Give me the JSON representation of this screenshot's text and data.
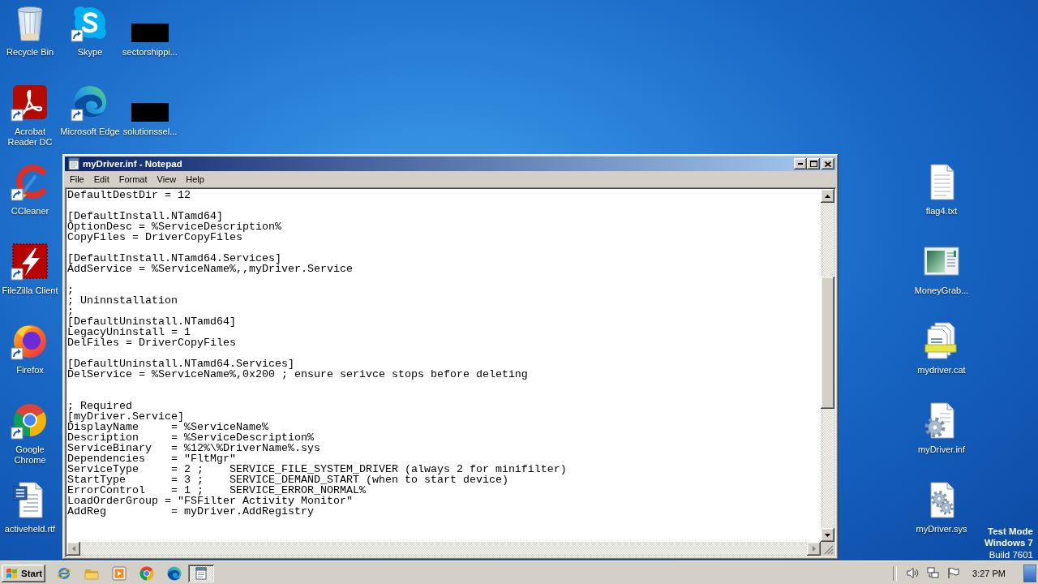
{
  "desktop": {
    "left_columns": [
      [
        {
          "label": "Recycle Bin",
          "kind": "recyclebin",
          "shortcut": false
        },
        {
          "label": "Acrobat Reader DC",
          "kind": "acrobat",
          "shortcut": true
        },
        {
          "label": "CCleaner",
          "kind": "ccleaner",
          "shortcut": true
        },
        {
          "label": "FileZilla Client",
          "kind": "filezilla",
          "shortcut": true
        },
        {
          "label": "Firefox",
          "kind": "firefox",
          "shortcut": true
        },
        {
          "label": "Google Chrome",
          "kind": "chrome",
          "shortcut": true
        },
        {
          "label": "activeheld.rtf",
          "kind": "worddoc",
          "shortcut": false
        }
      ],
      [
        {
          "label": "Skype",
          "kind": "skype",
          "shortcut": true
        },
        {
          "label": "Microsoft Edge",
          "kind": "edge",
          "shortcut": true
        }
      ],
      [
        {
          "label": "sectorshippi...",
          "kind": "thumbnail",
          "shortcut": false
        },
        {
          "label": "solutionssel...",
          "kind": "thumbnail",
          "shortcut": false
        }
      ]
    ],
    "right_column": [
      {
        "label": "flag4.txt",
        "kind": "textfile",
        "shortcut": false
      },
      {
        "label": "MoneyGrab...",
        "kind": "window",
        "shortcut": false
      },
      {
        "label": "mydriver.cat",
        "kind": "catalog",
        "shortcut": false
      },
      {
        "label": "myDriver.inf",
        "kind": "config",
        "shortcut": false
      },
      {
        "label": "myDriver.sys",
        "kind": "system",
        "shortcut": false
      }
    ],
    "edition": {
      "mode": "Test Mode",
      "os": "Windows 7",
      "build": "Build 7601"
    }
  },
  "window": {
    "title": "myDriver.inf - Notepad",
    "menu": [
      "File",
      "Edit",
      "Format",
      "View",
      "Help"
    ],
    "text": "DefaultDestDir = 12\n\n[DefaultInstall.NTamd64]\nOptionDesc = %ServiceDescription%\nCopyFiles = DriverCopyFiles\n\n[DefaultInstall.NTamd64.Services]\nAddService = %ServiceName%,,myDriver.Service\n\n;\n; Uninnstallation\n;\n[DefaultUninstall.NTamd64]\nLegacyUninstall = 1\nDelFiles = DriverCopyFiles\n\n[DefaultUninstall.NTamd64.Services]\nDelService = %ServiceName%,0x200 ; ensure serivce stops before deleting\n\n\n; Required\n[myDriver.Service]\nDisplayName     = %ServiceName%\nDescription     = %ServiceDescription%\nServiceBinary   = %12%\\%DriverName%.sys\nDependencies    = \"FltMgr\"\nServiceType     = 2 ;    SERVICE_FILE_SYSTEM_DRIVER (always 2 for minifilter)\nStartType       = 3 ;    SERVICE_DEMAND_START (when to start device)\nErrorControl    = 1 ;    SERVICE_ERROR_NORMAL%\nLoadOrderGroup = \"FSFilter Activity Monitor\"\nAddReg          = myDriver.AddRegistry"
  },
  "taskbar": {
    "start": "Start",
    "task_buttons": [
      {
        "selected": true
      }
    ],
    "clock": "3:27 PM"
  }
}
